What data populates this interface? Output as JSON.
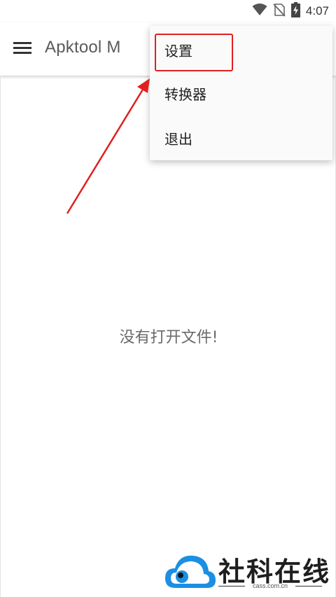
{
  "status_bar": {
    "time": "4:07",
    "icons": [
      "wifi-icon",
      "no-sim-icon",
      "battery-charging-icon"
    ]
  },
  "app_bar": {
    "title": "Apktool M",
    "menu_icon": "hamburger-menu-icon"
  },
  "menu": {
    "items": [
      {
        "label": "设置"
      },
      {
        "label": "转换器"
      },
      {
        "label": "退出"
      }
    ]
  },
  "main": {
    "empty_message": "没有打开文件!"
  },
  "watermark": {
    "title": "社科在线",
    "subtitle": "cass.com.cn"
  },
  "colors": {
    "annotation_red": "#e02020",
    "watermark_blue": "#1a8fe3"
  }
}
